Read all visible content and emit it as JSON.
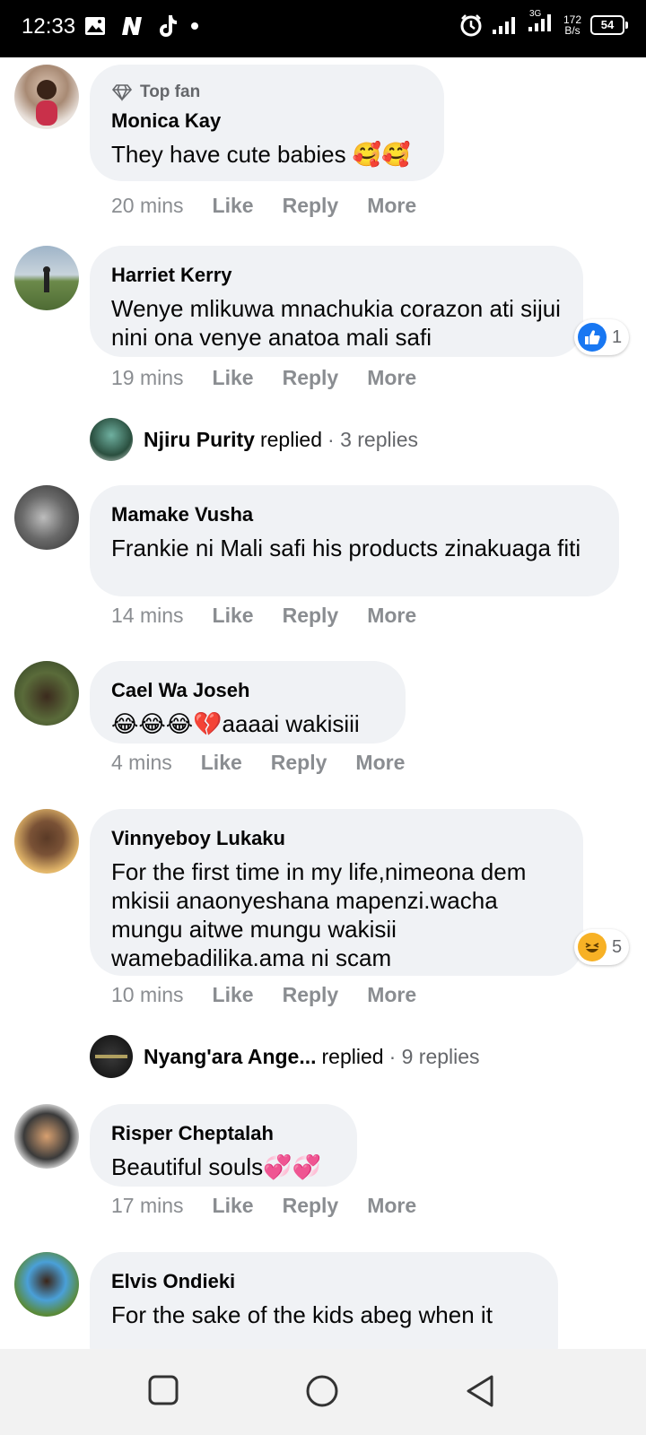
{
  "status_bar": {
    "time": "12:33",
    "network_type": "3G",
    "speed_value": "172",
    "speed_unit": "B/s",
    "battery": "54"
  },
  "comments": [
    {
      "badge": "Top fan",
      "author": "Monica Kay",
      "text": "They have cute babies 🥰🥰",
      "time": "20 mins",
      "like": "Like",
      "reply": "Reply",
      "more": "More"
    },
    {
      "author": "Harriet Kerry",
      "text": "Wenye mlikuwa mnachukia corazon ati sijui nini ona venye anatoa mali safi",
      "time": "19 mins",
      "like": "Like",
      "reply": "Reply",
      "more": "More",
      "reaction_count": "1"
    },
    {
      "author": "Mamake Vusha",
      "text": "Frankie ni Mali safi his products zinakuaga fiti",
      "time": "14 mins",
      "like": "Like",
      "reply": "Reply",
      "more": "More"
    },
    {
      "author": "Cael Wa Joseh",
      "text": "😂😂😂💔aaaai wakisiii",
      "time": "4 mins",
      "like": "Like",
      "reply": "Reply",
      "more": "More"
    },
    {
      "author": "Vinnyeboy Lukaku",
      "text": "For the first time in my life,nimeona dem mkisii anaonyeshana mapenzi.wacha mungu aitwe mungu wakisii wamebadilika.ama ni scam",
      "time": "10 mins",
      "like": "Like",
      "reply": "Reply",
      "more": "More",
      "reaction_count": "5"
    },
    {
      "author": "Risper Cheptalah",
      "text": "Beautiful souls💞💞",
      "time": "17 mins",
      "like": "Like",
      "reply": "Reply",
      "more": "More"
    },
    {
      "author": "Elvis Ondieki",
      "text": "For the sake of the kids abeg when it"
    }
  ],
  "replies": [
    {
      "name": "Njiru Purity",
      "verb": "replied",
      "count": "· 3 replies"
    },
    {
      "name": "Nyang'ara Ange...",
      "verb": "replied",
      "count": "· 9 replies"
    }
  ],
  "colors": {
    "bubble": "#f0f2f5",
    "meta": "#8a8d91",
    "like_blue": "#1877f2",
    "haha_yellow": "#f7b125"
  },
  "icons": {
    "badge": "diamond-icon",
    "reaction_like": "like-reaction-icon",
    "reaction_haha": "haha-reaction-icon",
    "nav_recent": "square-icon",
    "nav_home": "circle-icon",
    "nav_back": "triangle-back-icon"
  }
}
